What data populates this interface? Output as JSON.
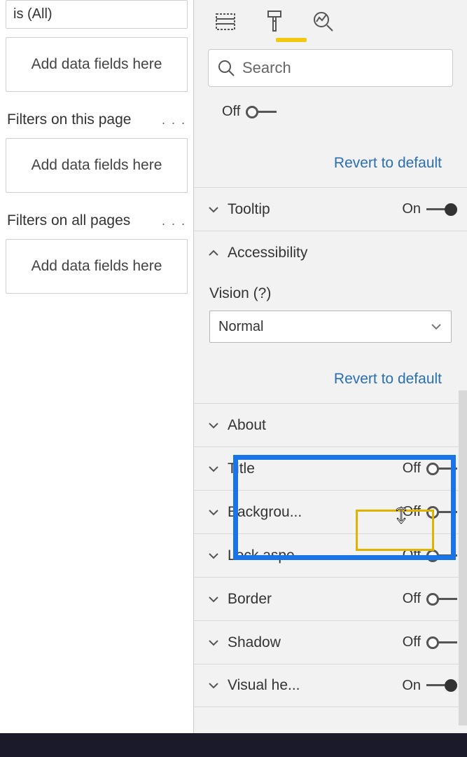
{
  "left": {
    "existing_filter": "is (All)",
    "dropzone_text": "Add data fields here",
    "section_page": "Filters on this page",
    "section_all": "Filters on all pages"
  },
  "search": {
    "placeholder": "Search"
  },
  "accessibility": {
    "header": "Accessibility",
    "label": "Vision (?)",
    "value": "Normal"
  },
  "revert": "Revert to default",
  "toggles": {
    "lonely": {
      "state": "Off"
    },
    "tooltip": {
      "label": "Tooltip",
      "state": "On"
    },
    "about": {
      "label": "About"
    },
    "title": {
      "label": "Title",
      "state": "Off"
    },
    "background": {
      "label": "Backgrou...",
      "state": "Off"
    },
    "lock": {
      "label": "Lock aspe...",
      "state": "Off"
    },
    "border": {
      "label": "Border",
      "state": "Off"
    },
    "shadow": {
      "label": "Shadow",
      "state": "Off"
    },
    "visualhe": {
      "label": "Visual he...",
      "state": "On"
    }
  }
}
